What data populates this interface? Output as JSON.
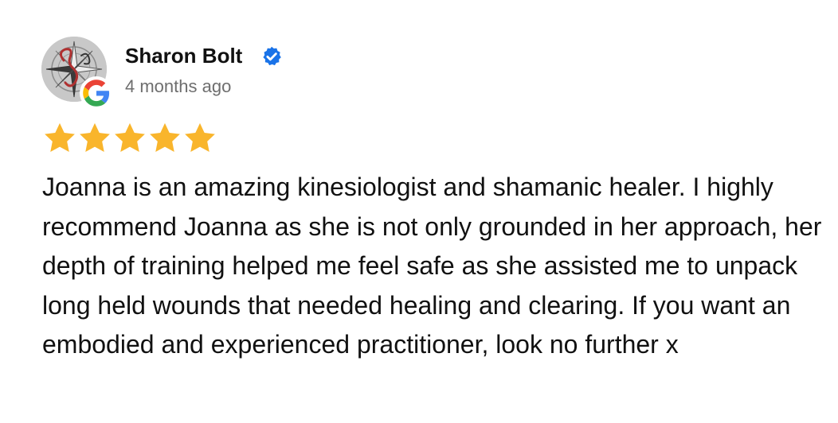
{
  "reviewer": {
    "name": "Sharon Bolt",
    "time": "4 months ago",
    "verified": true
  },
  "rating": {
    "stars": 5,
    "max": 5,
    "color": "#F9B52C"
  },
  "review_text": "Joanna is an amazing kinesiologist and shamanic healer. I highly recommend Joanna as she is not only grounded in her approach, her depth of training helped me feel safe as she assisted me to unpack long held wounds that needed healing and clearing. If you want an embodied and experienced practitioner, look no further x",
  "icons": {
    "source": "google-icon",
    "verified": "verified-badge-icon",
    "star": "star-icon"
  },
  "colors": {
    "verified_blue": "#1A73E8",
    "time_gray": "#6E6E6E",
    "google_blue": "#4285F4",
    "google_red": "#EA4335",
    "google_yellow": "#FBBC05",
    "google_green": "#34A853"
  }
}
